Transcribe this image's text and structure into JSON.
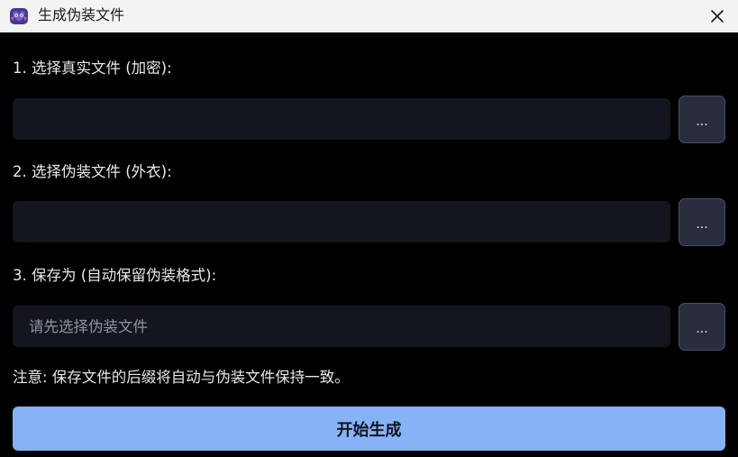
{
  "window": {
    "title": "生成伪装文件",
    "icon": "app-logo-icon",
    "close_icon": "close-icon"
  },
  "form": {
    "real_file": {
      "label": "1. 选择真实文件 (加密):",
      "value": "",
      "placeholder": "",
      "browse_label": "..."
    },
    "cover_file": {
      "label": "2. 选择伪装文件 (外衣):",
      "value": "",
      "placeholder": "",
      "browse_label": "..."
    },
    "save_as": {
      "label": "3. 保存为 (自动保留伪装格式):",
      "value": "",
      "placeholder": "请先选择伪装文件",
      "browse_label": "..."
    },
    "note": "注意: 保存文件的后缀将自动与伪装文件保持一致。",
    "start_label": "开始生成"
  },
  "colors": {
    "background": "#000000",
    "titlebar": "#f3f3f3",
    "field": "#14161f",
    "browse_button": "#2a2d3e",
    "primary_button": "#86b2f6",
    "text": "#e6e8ee",
    "placeholder": "#8e93a0"
  }
}
